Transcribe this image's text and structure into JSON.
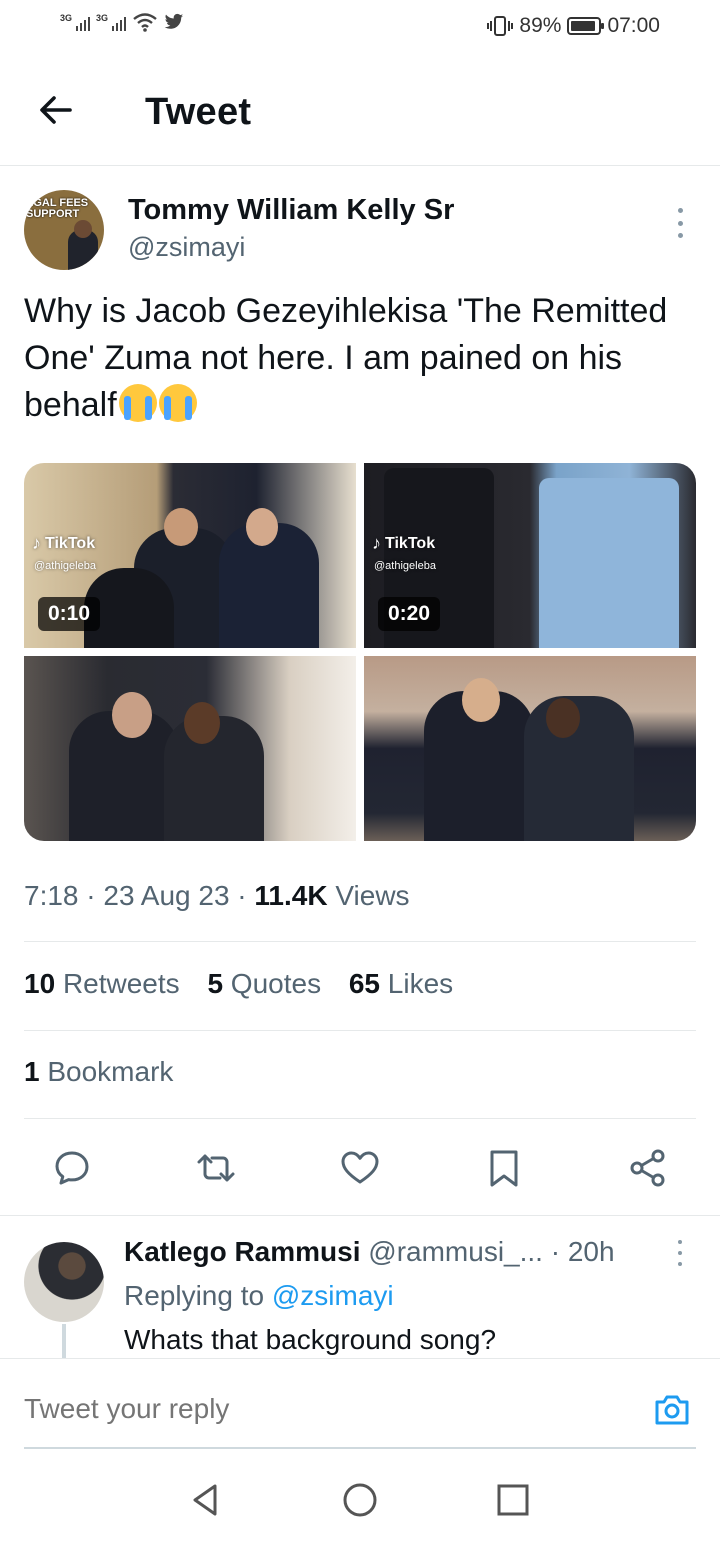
{
  "status_bar": {
    "network_1": "3G",
    "network_2": "3G",
    "battery_level": "89%",
    "time": "07:00"
  },
  "header": {
    "title": "Tweet"
  },
  "tweet": {
    "author_name": "Tommy William Kelly Sr",
    "author_handle": "@zsimayi",
    "avatar_text": "EGAL FEES SUPPORT",
    "text": "Why is Jacob Gezeyihlekisa 'The Remitted One' Zuma not here. I am pained on his behalf",
    "emojis": [
      "loudly-crying-face",
      "loudly-crying-face"
    ],
    "media": [
      {
        "type": "video",
        "brand": "TikTok",
        "user": "@athigeleba",
        "duration": "0:10"
      },
      {
        "type": "video",
        "brand": "TikTok",
        "user": "@athigeleba",
        "duration": "0:20"
      },
      {
        "type": "photo"
      },
      {
        "type": "photo"
      }
    ],
    "time": "7:18",
    "date": "23 Aug 23",
    "views_count": "11.4K",
    "views_label": "Views",
    "separator": "·",
    "retweets_count": "10",
    "retweets_label": "Retweets",
    "quotes_count": "5",
    "quotes_label": "Quotes",
    "likes_count": "65",
    "likes_label": "Likes",
    "bookmarks_count": "1",
    "bookmarks_label": "Bookmark"
  },
  "reply": {
    "author_name": "Katlego Rammusi",
    "author_handle": "@rammusi_...",
    "time": "· 20h",
    "replying_label": "Replying to",
    "replying_to": "@zsimayi",
    "text": "Whats that background song?"
  },
  "composer": {
    "placeholder": "Tweet your reply"
  },
  "colors": {
    "accent": "#1d9bf0",
    "text_primary": "#0f1419",
    "text_secondary": "#536471",
    "divider": "#e6e9ea"
  }
}
